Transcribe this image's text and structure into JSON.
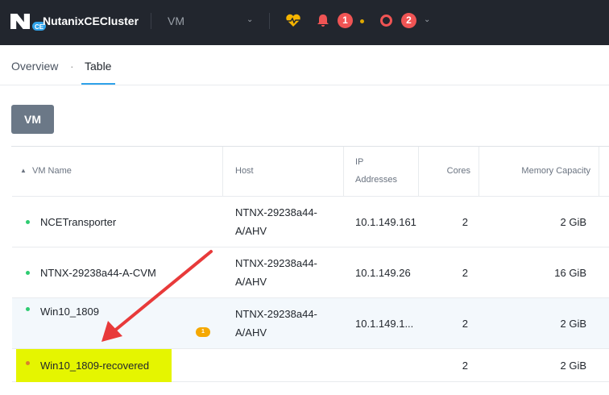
{
  "header": {
    "cluster_name": "NutanixCEClusterName",
    "logo_badge": "CE",
    "entity": "VM",
    "alerts_count": "1",
    "tasks_count": "2"
  },
  "tabs": [
    {
      "label": "Overview"
    },
    {
      "label": "Table"
    }
  ],
  "tab_separator": "·",
  "entity_button": "VM",
  "table": {
    "headers": {
      "name": "VM Name",
      "host": "Host",
      "ip": "IP Addresses",
      "ip1": "IP",
      "ip2": "Addresses",
      "cores": "Cores",
      "memory": "Memory Capacity"
    },
    "rows": [
      {
        "name": "NCETransporter",
        "host1": "NTNX-29238a44-",
        "host2": "A/AHV",
        "ip": "10.1.149.161",
        "cores": "2",
        "memory": "2 GiB",
        "status_color": "#2ecc71"
      },
      {
        "name": "NTNX-29238a44-A-CVM",
        "host1": "NTNX-29238a44-",
        "host2": "A/AHV",
        "ip": "10.1.149.26",
        "cores": "2",
        "memory": "16 GiB",
        "status_color": "#2ecc71"
      },
      {
        "name": "Win10_1809",
        "host1": "NTNX-29238a44-",
        "host2": "A/AHV",
        "ip": "10.1.149.1...",
        "cores": "2",
        "memory": "2 GiB",
        "status_color": "#2ecc71",
        "alert_badge": "1"
      },
      {
        "name": "Win10_1809-recovered",
        "host1": "",
        "host2": "",
        "ip": "",
        "cores": "2",
        "memory": "2 GiB",
        "status_color": "#d9822b"
      }
    ]
  },
  "colors": {
    "highlight": "#e5f500",
    "arrow": "#e83a3a"
  }
}
